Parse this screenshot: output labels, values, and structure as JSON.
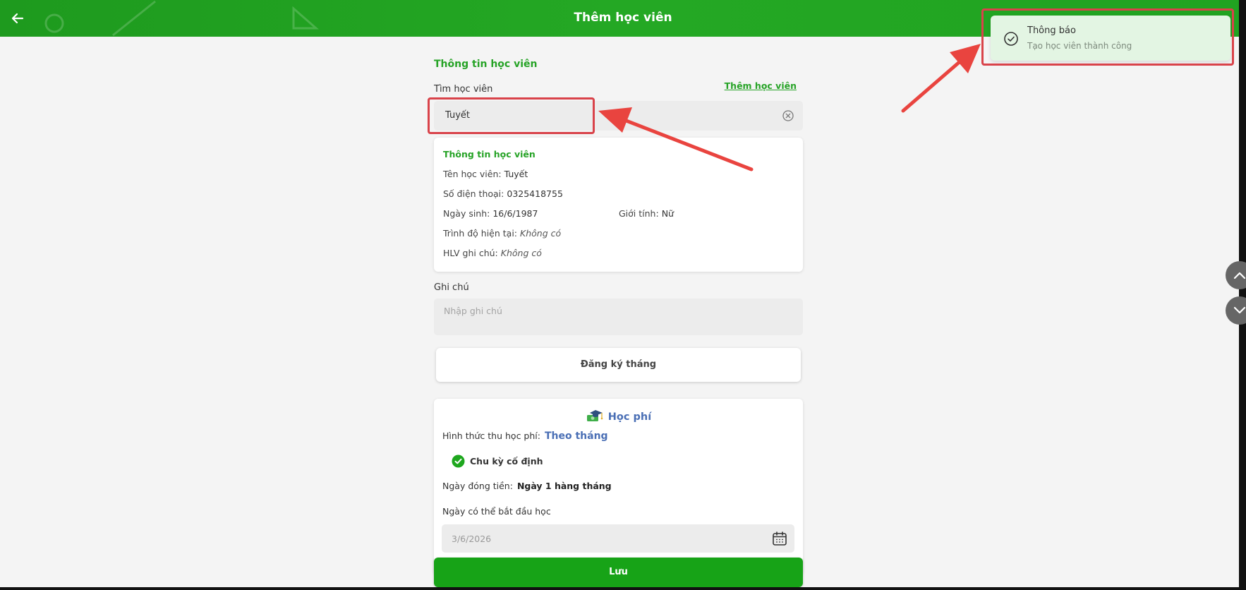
{
  "header": {
    "back_icon": "arrow-left-icon",
    "title": "Thêm học viên"
  },
  "toast": {
    "icon": "check-circle-icon",
    "title": "Thông báo",
    "message": "Tạo học viên thành công"
  },
  "form": {
    "section_title": "Thông tin học viên",
    "search_label": "Tìm học viên",
    "add_student_link": "Thêm học viên",
    "search_value": "Tuyết",
    "clear_icon": "clear-circle-icon"
  },
  "student_card": {
    "title": "Thông tin học viên",
    "name_label": "Tên học viên:",
    "name_value": "Tuyết",
    "phone_label": "Số điện thoại:",
    "phone_value": "0325418755",
    "dob_label": "Ngày sinh:",
    "dob_value": "16/6/1987",
    "gender_label": "Giới tính:",
    "gender_value": "Nữ",
    "level_label": "Trình độ hiện tại:",
    "level_value": "Không có",
    "coach_note_label": "HLV ghi chú:",
    "coach_note_value": "Không có"
  },
  "note": {
    "label": "Ghi chú",
    "placeholder": "Nhập ghi chú"
  },
  "month_register_button": "Đăng ký tháng",
  "fee_card": {
    "title": "Học phí",
    "title_icon": "graduation-cap-money-icon",
    "method_label": "Hình thức thu học phí:",
    "method_value": "Theo tháng",
    "fixed_cycle_label": "Chu kỳ cố định",
    "fixed_cycle_checked": true,
    "pay_day_label": "Ngày đóng tiền:",
    "pay_day_value": "Ngày 1 hàng tháng",
    "start_date_label": "Ngày có thể bắt đầu học",
    "start_date_value": "3/6/2026",
    "calendar_icon": "calendar-icon"
  },
  "save_button": "Lưu",
  "scroll_buttons": {
    "up_icon": "chevron-up-icon",
    "down_icon": "chevron-down-icon"
  },
  "colors": {
    "brand_green": "#21a321",
    "toast_bg": "#e3f5e3",
    "accent_blue": "#4a6fb5",
    "annotation_red": "#d9434a"
  }
}
